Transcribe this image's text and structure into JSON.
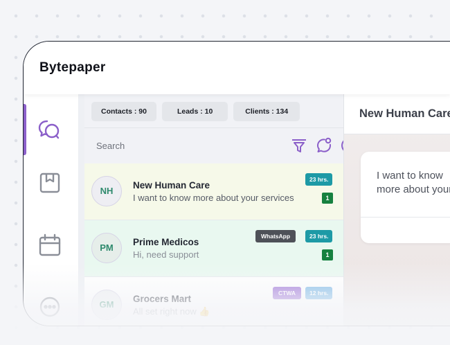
{
  "app": {
    "brand": "Bytepaper"
  },
  "stats": [
    {
      "label": "Contacts : 90"
    },
    {
      "label": "Leads : 10"
    },
    {
      "label": "Clients : 134"
    }
  ],
  "search": {
    "label": "Search"
  },
  "sidebar_icons": [
    "chat-bubbles-icon",
    "bookmark-box-icon",
    "calendar-icon",
    "more-icon"
  ],
  "toolbar_icons": [
    "filter-icon",
    "new-conversation-icon",
    "add-icon"
  ],
  "conversations": [
    {
      "initials": "NH",
      "name": "New Human Care",
      "message": "I want to know more about your services",
      "time": "23 hrs.",
      "channel": "",
      "unread": "1",
      "background": "#f6f9e9"
    },
    {
      "initials": "PM",
      "name": "Prime Medicos",
      "message": "Hi, need support",
      "time": "23 hrs.",
      "channel": "WhatsApp",
      "unread": "1",
      "background": "#e9f8f0"
    },
    {
      "initials": "GM",
      "name": "Grocers Mart",
      "message": "All set right now 👍",
      "time": "12 hrs.",
      "channel": "CTWA",
      "unread": "",
      "background": "#ffffff"
    }
  ],
  "chat": {
    "contact_name": "New Human Care",
    "message": "I want to know more about your services"
  },
  "colors": {
    "accent": "#8b5fc9",
    "time_badge": "#1d9aa6",
    "unread_badge": "#16813f",
    "avatar_text": "#2f8a6d",
    "ctwa_badge": "#9b6fd6"
  }
}
